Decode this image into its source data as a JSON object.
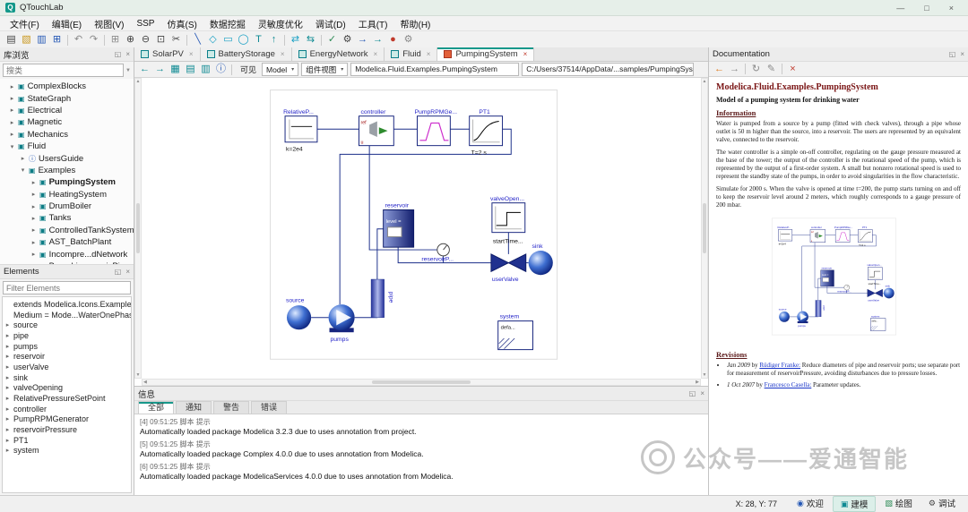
{
  "window": {
    "title": "QTouchLab"
  },
  "icons": {
    "min": "—",
    "max": "□",
    "close": "×",
    "float": "◱",
    "funnel": "▼",
    "caret": "▾",
    "up": "▲",
    "down": "▼",
    "left": "◀",
    "right": "▶"
  },
  "menubar": [
    "文件(F)",
    "编辑(E)",
    "视图(V)",
    "SSP",
    "仿真(S)",
    "数据挖掘",
    "灵敏度优化",
    "调试(D)",
    "工具(T)",
    "帮助(H)"
  ],
  "toolbar": [
    {
      "name": "new-model-icon",
      "glyph": "▤",
      "cls": "c-dark"
    },
    {
      "name": "open-file-icon",
      "glyph": "▧",
      "cls": "c-yellow"
    },
    {
      "name": "save-icon",
      "glyph": "▥",
      "cls": "c-blue"
    },
    {
      "name": "save-all-icon",
      "glyph": "⊞",
      "cls": "c-blue"
    },
    {
      "cls": "sep"
    },
    {
      "name": "undo-icon",
      "glyph": "↶",
      "cls": "c-gray"
    },
    {
      "name": "redo-icon",
      "glyph": "↷",
      "cls": "c-gray"
    },
    {
      "cls": "sep"
    },
    {
      "name": "grid-icon",
      "glyph": "⊞",
      "cls": "c-gray"
    },
    {
      "name": "zoom-in-icon",
      "glyph": "⊕",
      "cls": "c-dark"
    },
    {
      "name": "zoom-out-icon",
      "glyph": "⊖",
      "cls": "c-dark"
    },
    {
      "name": "zoom-fit-icon",
      "glyph": "⊡",
      "cls": "c-dark"
    },
    {
      "name": "cut-icon",
      "glyph": "✂",
      "cls": "c-dark"
    },
    {
      "cls": "sep"
    },
    {
      "name": "line-tool-icon",
      "glyph": "╲",
      "cls": "c-blue"
    },
    {
      "name": "polygon-tool-icon",
      "glyph": "◇",
      "cls": "c-cyan"
    },
    {
      "name": "rect-tool-icon",
      "glyph": "▭",
      "cls": "c-cyan"
    },
    {
      "name": "ellipse-tool-icon",
      "glyph": "◯",
      "cls": "c-cyan"
    },
    {
      "name": "text-tool-icon",
      "glyph": "T",
      "cls": "c-teal"
    },
    {
      "name": "arrow-tool-icon",
      "glyph": "↑",
      "cls": "c-teal"
    },
    {
      "cls": "sep"
    },
    {
      "name": "connect-mode-icon",
      "glyph": "⇄",
      "cls": "c-cyan"
    },
    {
      "name": "bus-connect-icon",
      "glyph": "⇆",
      "cls": "c-teal"
    },
    {
      "cls": "sep"
    },
    {
      "name": "check-model-icon",
      "glyph": "✓",
      "cls": "c-green"
    },
    {
      "name": "settings-icon",
      "glyph": "⚙",
      "cls": "c-dark"
    },
    {
      "name": "simulate-icon",
      "glyph": "→",
      "cls": "c-blue"
    },
    {
      "name": "simulate-result-icon",
      "glyph": "→",
      "cls": "c-teal"
    },
    {
      "name": "record-icon",
      "glyph": "●",
      "cls": "c-red"
    },
    {
      "name": "tools-icon",
      "glyph": "⚙",
      "cls": "c-gray"
    }
  ],
  "library": {
    "title": "库浏览",
    "filter_placeholder": "搜类",
    "tree": [
      {
        "caret": "▸",
        "icon": "▣",
        "label": "ComplexBlocks",
        "pad": 10
      },
      {
        "caret": "▸",
        "icon": "▣",
        "label": "StateGraph",
        "pad": 10
      },
      {
        "caret": "▸",
        "icon": "▣",
        "label": "Electrical",
        "pad": 10
      },
      {
        "caret": "▸",
        "icon": "▣",
        "label": "Magnetic",
        "pad": 10
      },
      {
        "caret": "▸",
        "icon": "▣",
        "label": "Mechanics",
        "pad": 10
      },
      {
        "caret": "▾",
        "icon": "▣",
        "label": "Fluid",
        "pad": 10
      },
      {
        "caret": "▸",
        "icon": "ⓘ",
        "label": "UsersGuide",
        "pad": 22,
        "cls": "t-info"
      },
      {
        "caret": "▾",
        "icon": "▣",
        "label": "Examples",
        "pad": 22
      },
      {
        "caret": "▸",
        "icon": "▣",
        "label": "PumpingSystem",
        "pad": 34,
        "cls": "bold"
      },
      {
        "caret": "▸",
        "icon": "▣",
        "label": "HeatingSystem",
        "pad": 34
      },
      {
        "caret": "▸",
        "icon": "▣",
        "label": "DrumBoiler",
        "pad": 34
      },
      {
        "caret": "▸",
        "icon": "▣",
        "label": "Tanks",
        "pad": 34
      },
      {
        "caret": "▸",
        "icon": "▣",
        "label": "ControlledTankSystem",
        "pad": 34
      },
      {
        "caret": "▸",
        "icon": "▣",
        "label": "AST_BatchPlant",
        "pad": 34
      },
      {
        "caret": "▸",
        "icon": "▣",
        "label": "Incompre...dNetwork",
        "pad": 34
      },
      {
        "caret": "▸",
        "icon": "▣",
        "label": "Branching...amicPipes",
        "pad": 34
      }
    ]
  },
  "elements": {
    "title": "Elements",
    "filter_placeholder": "Filter Elements",
    "items": [
      {
        "caret": "",
        "label": "extends Modelica.Icons.Example"
      },
      {
        "caret": "",
        "label": "Medium = Mode...WaterOnePhase"
      },
      {
        "caret": "▸",
        "label": "source"
      },
      {
        "caret": "▸",
        "label": "pipe"
      },
      {
        "caret": "▸",
        "label": "pumps"
      },
      {
        "caret": "▸",
        "label": "reservoir"
      },
      {
        "caret": "▸",
        "label": "userValve"
      },
      {
        "caret": "▸",
        "label": "sink"
      },
      {
        "caret": "▸",
        "label": "valveOpening"
      },
      {
        "caret": "▸",
        "label": "RelativePressureSetPoint"
      },
      {
        "caret": "▸",
        "label": "controller"
      },
      {
        "caret": "▸",
        "label": "PumpRPMGenerator"
      },
      {
        "caret": "▸",
        "label": "reservoirPressure"
      },
      {
        "caret": "▸",
        "label": "PT1"
      },
      {
        "caret": "▸",
        "label": "system"
      }
    ]
  },
  "tabs": [
    {
      "label": "SolarPV",
      "close": "×"
    },
    {
      "label": "BatteryStorage",
      "close": "×"
    },
    {
      "label": "EnergyNetwork",
      "close": "×"
    },
    {
      "label": "Fluid",
      "close": "×"
    },
    {
      "label": "PumpingSystem",
      "close": "×",
      "cls": "active"
    }
  ],
  "canvas_toolbar": {
    "icons": [
      {
        "name": "back-icon",
        "glyph": "←",
        "cls": "c-teal"
      },
      {
        "name": "forward-icon",
        "glyph": "→",
        "cls": "c-teal"
      },
      {
        "name": "diagram-view-icon",
        "glyph": "▦",
        "cls": "c-teal"
      },
      {
        "name": "icon-view-icon",
        "glyph": "▤",
        "cls": "c-teal"
      },
      {
        "name": "text-view-icon",
        "glyph": "▥",
        "cls": "c-teal"
      },
      {
        "name": "info-icon",
        "glyph": "ⓘ",
        "cls": "c-blue"
      },
      {
        "cls": "sep"
      }
    ],
    "visible_label": "可见",
    "view_combo": "Model",
    "mode_combo": "组件视图",
    "model_name": "Modelica.Fluid.Examples.PumpingSystem",
    "file_path": "C:/Users/37514/AppData/...samples/PumpingSystem.mo"
  },
  "diagram": {
    "labels": {
      "relative": "RelativeP...",
      "relative_param": "k=2e4",
      "controller": "controller",
      "controller_ref": "ref",
      "controller_u": "u",
      "pumprpm": "PumpRPMGe...",
      "pt1": "PT1",
      "pt1_param": "T=2 s",
      "valveopen": "valveOpen...",
      "valveopen_param": "startTime...",
      "reservoir": "reservoir",
      "reservoir_level": "level =",
      "reservoirp": "reservoirP...",
      "sink": "sink",
      "uservalve": "userValve",
      "source": "source",
      "pumps": "pumps",
      "pipe": "pipe",
      "system": "system",
      "system_text": "defa..."
    }
  },
  "info": {
    "title": "信息",
    "tabs": [
      {
        "label": "全部",
        "cls": "active"
      },
      {
        "label": "通知"
      },
      {
        "label": "警告"
      },
      {
        "label": "错误"
      }
    ],
    "messages": [
      {
        "header": "[4] 09:51:25 脚本 提示",
        "body": "Automatically loaded package Modelica 3.2.3 due to uses annotation from project."
      },
      {
        "header": "[5] 09:51:25 脚本 提示",
        "body": "Automatically loaded package Complex 4.0.0 due to uses annotation from Modelica."
      },
      {
        "header": "[6] 09:51:25 脚本 提示",
        "body": "Automatically loaded package ModelicaServices 4.0.0 due to uses annotation from Modelica."
      }
    ]
  },
  "doc": {
    "panel_title": "Documentation",
    "toolbar": [
      {
        "name": "doc-back-icon",
        "glyph": "←",
        "cls": "c-orange"
      },
      {
        "name": "doc-forward-icon",
        "glyph": "→",
        "cls": "c-gray"
      },
      {
        "cls": "sep"
      },
      {
        "name": "doc-refresh-icon",
        "glyph": "↻",
        "cls": "c-gray"
      },
      {
        "name": "doc-edit-icon",
        "glyph": "✎",
        "cls": "c-gray"
      },
      {
        "cls": "sep"
      },
      {
        "name": "doc-close-icon",
        "glyph": "×",
        "cls": "c-red"
      }
    ],
    "title": "Modelica.Fluid.Examples.PumpingSystem",
    "subtitle": "Model of a pumping system for drinking water",
    "info_heading": "Information",
    "paragraphs": [
      "Water is pumped from a source by a pump (fitted with check valves), through a pipe whose outlet is 50 m higher than the source, into a reservoir. The users are represented by an equivalent valve, connected to the reservoir.",
      "The water controller is a simple on-off controller, regulating on the gauge pressure measured at the base of the tower; the output of the controller is the rotational speed of the pump, which is represented by the output of a first-order system. A small but nonzero rotational speed is used to represent the standby state of the pumps, in order to avoid singularities in the flow characteristic.",
      "Simulate for 2000 s. When the valve is opened at time t=200, the pump starts turning on and off to keep the reservoir level around 2 meters, which roughly corresponds to a gauge pressure of 200 mbar."
    ],
    "revisions_heading": "Revisions",
    "revisions": [
      {
        "date": "Jan 2009",
        "by": "by",
        "author": "Rüdiger Franke:",
        "text": " Reduce diameters of pipe and reservoir ports; use separate port for measurement of reservoirPressure, avoiding disturbances due to pressure losses."
      },
      {
        "date": "1 Oct 2007",
        "by": "by",
        "author": "Francesco Casella:",
        "text": " Parameter updates."
      }
    ]
  },
  "status": {
    "coords": "X: 28,  Y: 77",
    "modes": [
      {
        "name": "welcome-mode-button",
        "glyph": "◉",
        "label": "欢迎",
        "cls": "c-blue"
      },
      {
        "name": "modeling-mode-button",
        "glyph": "▣",
        "label": "建模",
        "cls": "active c-teal"
      },
      {
        "name": "plotting-mode-button",
        "glyph": "▧",
        "label": "绘图",
        "cls": "c-green"
      },
      {
        "name": "debug-mode-button",
        "glyph": "⚙",
        "label": "调试",
        "cls": "c-dark"
      }
    ]
  },
  "watermark": {
    "text": "公众号——爱通智能"
  }
}
